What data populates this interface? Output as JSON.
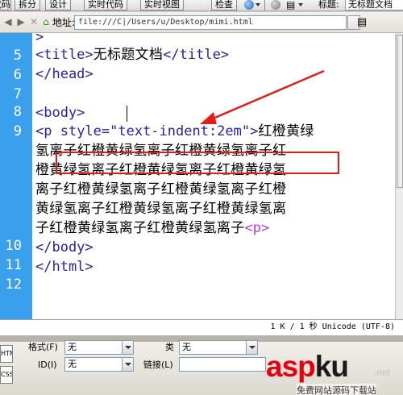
{
  "toolbar": {
    "code_fragment": "代码",
    "split": "拆分",
    "design": "设计",
    "live_code": "实时代码",
    "live_view": "实时视图",
    "inspect": "检查",
    "title_label": "标题:",
    "title_value": "无标题文档"
  },
  "address": {
    "label": "地址:",
    "url": "file:///C|/Users/u/Desktop/mimi.html"
  },
  "code": {
    "line_numbers": [
      "5",
      "6",
      "7",
      "8",
      "9",
      "10",
      "11",
      "12"
    ],
    "line_top_partial": ">",
    "line5": {
      "open": "<title>",
      "text": "无标题文档",
      "close": "</title>"
    },
    "line6": "</head>",
    "line8": "<body>",
    "line9": {
      "tag_start": "<p ",
      "attr": "style=\"text-indent:2em\"",
      "tag_end": ">",
      "text_start": "红橙黄绿"
    },
    "wrapped": [
      "氢离子红橙黄绿氢离子红橙黄绿氢离子红",
      "橙黄绿氢离子红橙黄绿氢离子红橙黄绿氢",
      "离子红橙黄绿氢离子红橙黄绿氢离子红橙",
      "黄绿氢离子红橙黄绿氢离子红橙黄绿氢离"
    ],
    "wrap_last_text": "子红橙黄绿氢离子红橙黄绿氢离子",
    "wrap_last_tag": "<p>",
    "line10": "</body>",
    "line11": "</html>"
  },
  "status": {
    "text": "1 K / 1 秒 Unicode (UTF-8)"
  },
  "properties": {
    "html_btn": "HTML",
    "css_btn": "CSS",
    "format_label": "格式(F)",
    "format_value": "无",
    "class_label": "类",
    "class_value": "无",
    "id_label": "ID(I)",
    "id_value": "无",
    "link_label": "链接(L)"
  },
  "watermark": {
    "asp": "asp",
    "ku": "ku",
    "net": ".net",
    "slogan": "免费网站源码下载站"
  },
  "colors": {
    "gutter": "#3aa0eb",
    "tag": "#2a1ea3",
    "highlight": "#e21b1b",
    "watermark": "#e60012"
  }
}
